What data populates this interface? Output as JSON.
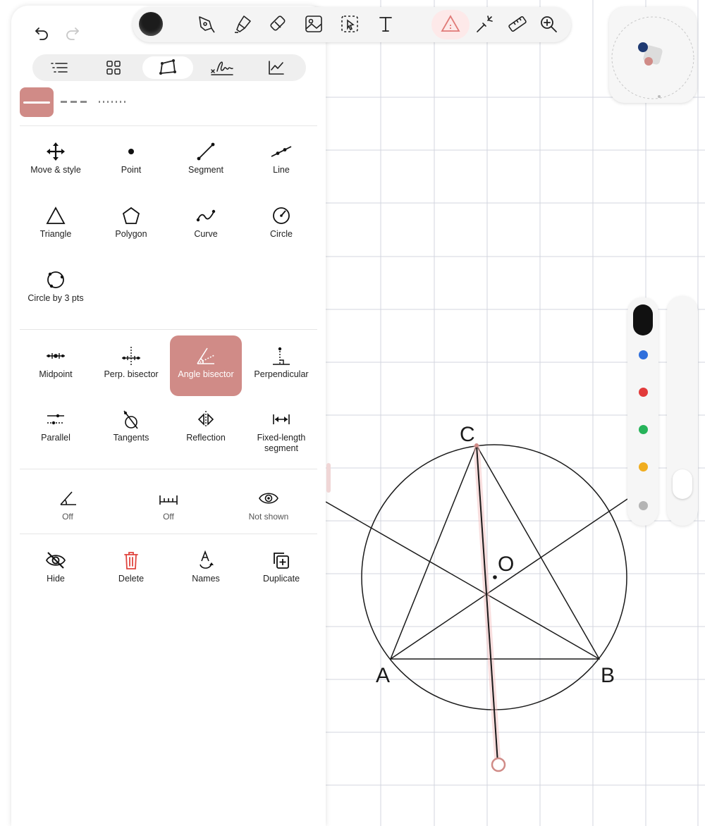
{
  "canvas": {
    "points": [
      "A",
      "B",
      "C",
      "O"
    ],
    "grid_color": "#cfd3de"
  },
  "sidebar": {
    "tabs": [
      "list-icon",
      "grid-icon",
      "geometry-icon",
      "signature-icon",
      "graph-icon"
    ],
    "active_tab": "geometry-icon",
    "line_styles": [
      "solid",
      "dashed",
      "dotted"
    ],
    "active_line_style": "solid",
    "tools_basic": [
      {
        "label": "Move & style",
        "icon": "move-icon"
      },
      {
        "label": "Point",
        "icon": "point-icon"
      },
      {
        "label": "Segment",
        "icon": "segment-icon"
      },
      {
        "label": "Line",
        "icon": "line-icon"
      },
      {
        "label": "Triangle",
        "icon": "triangle-icon"
      },
      {
        "label": "Polygon",
        "icon": "polygon-icon"
      },
      {
        "label": "Curve",
        "icon": "curve-icon"
      },
      {
        "label": "Circle",
        "icon": "circle-icon"
      },
      {
        "label": "Circle by 3 pts",
        "icon": "circle-3pts-icon"
      }
    ],
    "tools_construct": [
      {
        "label": "Midpoint",
        "icon": "midpoint-icon"
      },
      {
        "label": "Perp. bisector",
        "icon": "perp-bisector-icon"
      },
      {
        "label": "Angle bisector",
        "icon": "angle-bisector-icon"
      },
      {
        "label": "Perpendicular",
        "icon": "perpendicular-icon"
      },
      {
        "label": "Parallel",
        "icon": "parallel-icon"
      },
      {
        "label": "Tangents",
        "icon": "tangents-icon"
      },
      {
        "label": "Reflection",
        "icon": "reflection-icon"
      },
      {
        "label": "Fixed-length segment",
        "icon": "fixed-length-icon"
      }
    ],
    "active_tool": "Angle bisector",
    "display_settings": [
      {
        "label": "Off",
        "icon": "angle-measure-icon"
      },
      {
        "label": "Off",
        "icon": "length-measure-icon"
      },
      {
        "label": "Not shown",
        "icon": "eye-icon"
      }
    ],
    "actions": [
      {
        "label": "Hide",
        "icon": "eye-off-icon"
      },
      {
        "label": "Delete",
        "icon": "trash-icon"
      },
      {
        "label": "Names",
        "icon": "names-icon"
      },
      {
        "label": "Duplicate",
        "icon": "duplicate-icon"
      }
    ]
  },
  "toolbar": {
    "current_color": "#1c1c1c",
    "tools": [
      "pen-icon",
      "highlighter-icon",
      "eraser-icon",
      "image-icon",
      "lasso-icon",
      "text-icon",
      "geometry-icon",
      "laser-icon",
      "ruler-icon",
      "zoom-icon"
    ],
    "active_tool": "geometry-icon"
  },
  "palette": {
    "selected": "#111111",
    "colors": [
      "#2f6fdc",
      "#e23b3b",
      "#27b35a",
      "#f0ad1f",
      "#b4b4b4"
    ]
  },
  "accent_color": "#d08b87"
}
